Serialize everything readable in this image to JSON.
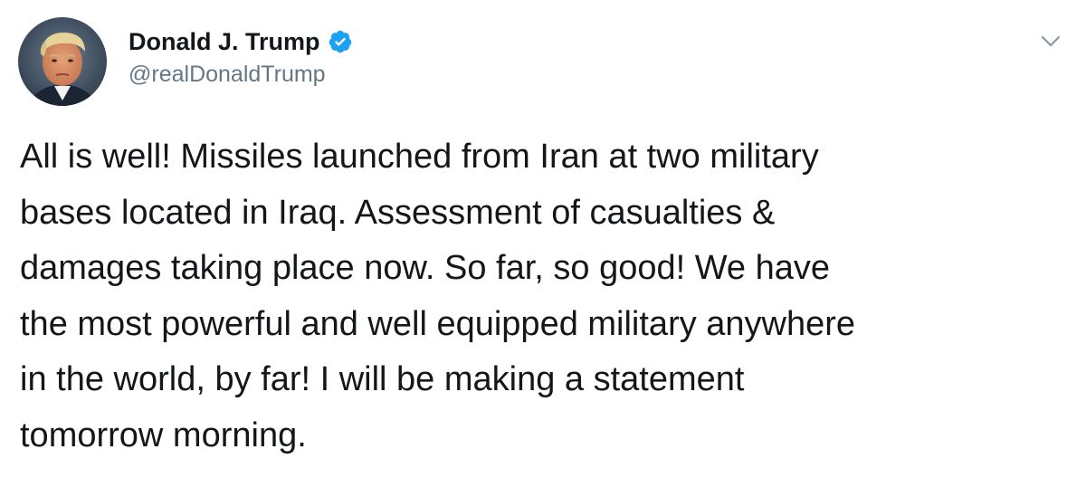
{
  "tweet": {
    "author": {
      "display_name": "Donald J. Trump",
      "handle": "@realDonaldTrump",
      "verified": true
    },
    "text_lines": [
      "All is well! Missiles launched from Iran at two military",
      "bases located in Iraq. Assessment of casualties &",
      "damages taking place now. So far, so good! We have",
      "the most powerful and well equipped military anywhere",
      "in the world, by far! I will be making a statement",
      "tomorrow morning."
    ]
  },
  "icons": {
    "avatar": "avatar-photo",
    "verified": "verified-badge-icon",
    "menu": "chevron-down-icon"
  },
  "colors": {
    "text": "#14171a",
    "secondary_text": "#657786",
    "verified_blue": "#1da1f2",
    "background": "#ffffff"
  }
}
